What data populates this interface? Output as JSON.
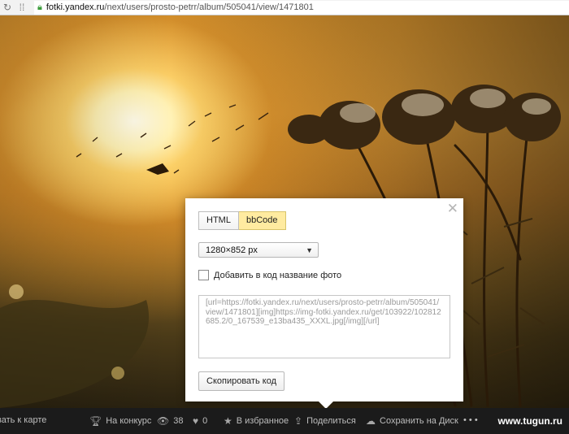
{
  "browser": {
    "url_host": "fotki.yandex.ru",
    "url_path": "/next/users/prosto-petrr/album/505041/view/1471801"
  },
  "popup": {
    "tabs": [
      {
        "label": "HTML",
        "active": false
      },
      {
        "label": "bbCode",
        "active": true
      }
    ],
    "size_select": "1280×852 px",
    "checkbox_label": "Добавить в код название фото",
    "checkbox_checked": false,
    "code": "[url=https://fotki.yandex.ru/next/users/prosto-petrr/album/505041/view/1471801][img]https://img-fotki.yandex.ru/get/103922/102812685.2/0_167539_e13ba435_XXXL.jpg[/img][/url]",
    "copy_button": "Скопировать код"
  },
  "toolbar": {
    "map": "вать к карте",
    "contest": "На конкурс",
    "views": "38",
    "likes": "0",
    "favorites": "В избранное",
    "share": "Поделиться",
    "save_disk": "Сохранить на Диск",
    "more": "• • •",
    "brand": "www.tugun.ru"
  },
  "colors": {
    "toolbar_bg": "#1b1b1b",
    "active_tab": "#ffeba0",
    "lock": "#3a9c3a"
  }
}
